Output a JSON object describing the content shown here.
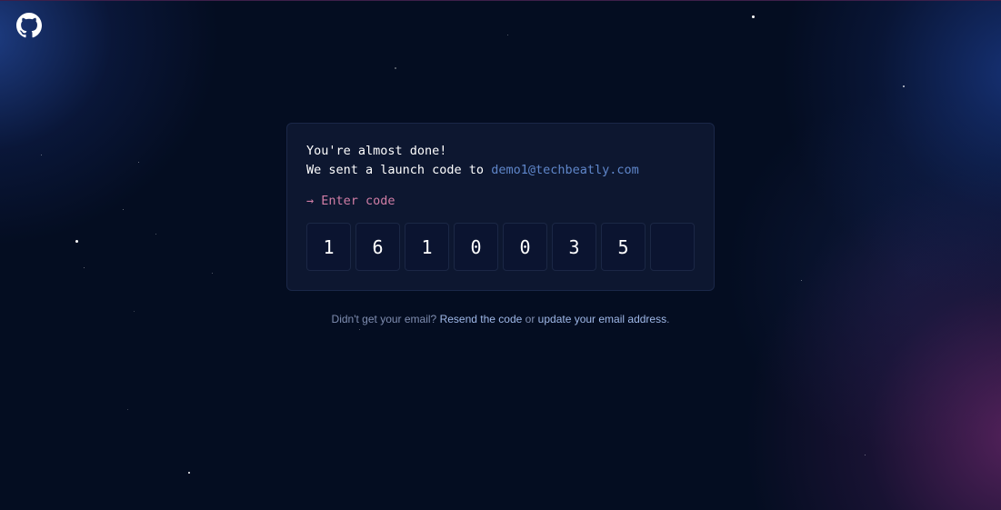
{
  "card": {
    "title": "You're almost done!",
    "sent_text": "We sent a launch code to",
    "email": "demo1@techbeatly.com",
    "prompt_arrow": "→",
    "prompt_label": "Enter code",
    "code_digits": [
      "1",
      "6",
      "1",
      "0",
      "0",
      "3",
      "5",
      ""
    ]
  },
  "footer": {
    "question": "Didn't get your email?",
    "resend_link": "Resend the code",
    "or_text": "or",
    "update_link": "update your email address",
    "period": "."
  },
  "icons": {
    "logo": "github-octocat-icon"
  },
  "colors": {
    "background": "#040d21",
    "email_link": "#5f86c9",
    "prompt": "#d17ea6",
    "footer_link": "#9fb8e8"
  }
}
